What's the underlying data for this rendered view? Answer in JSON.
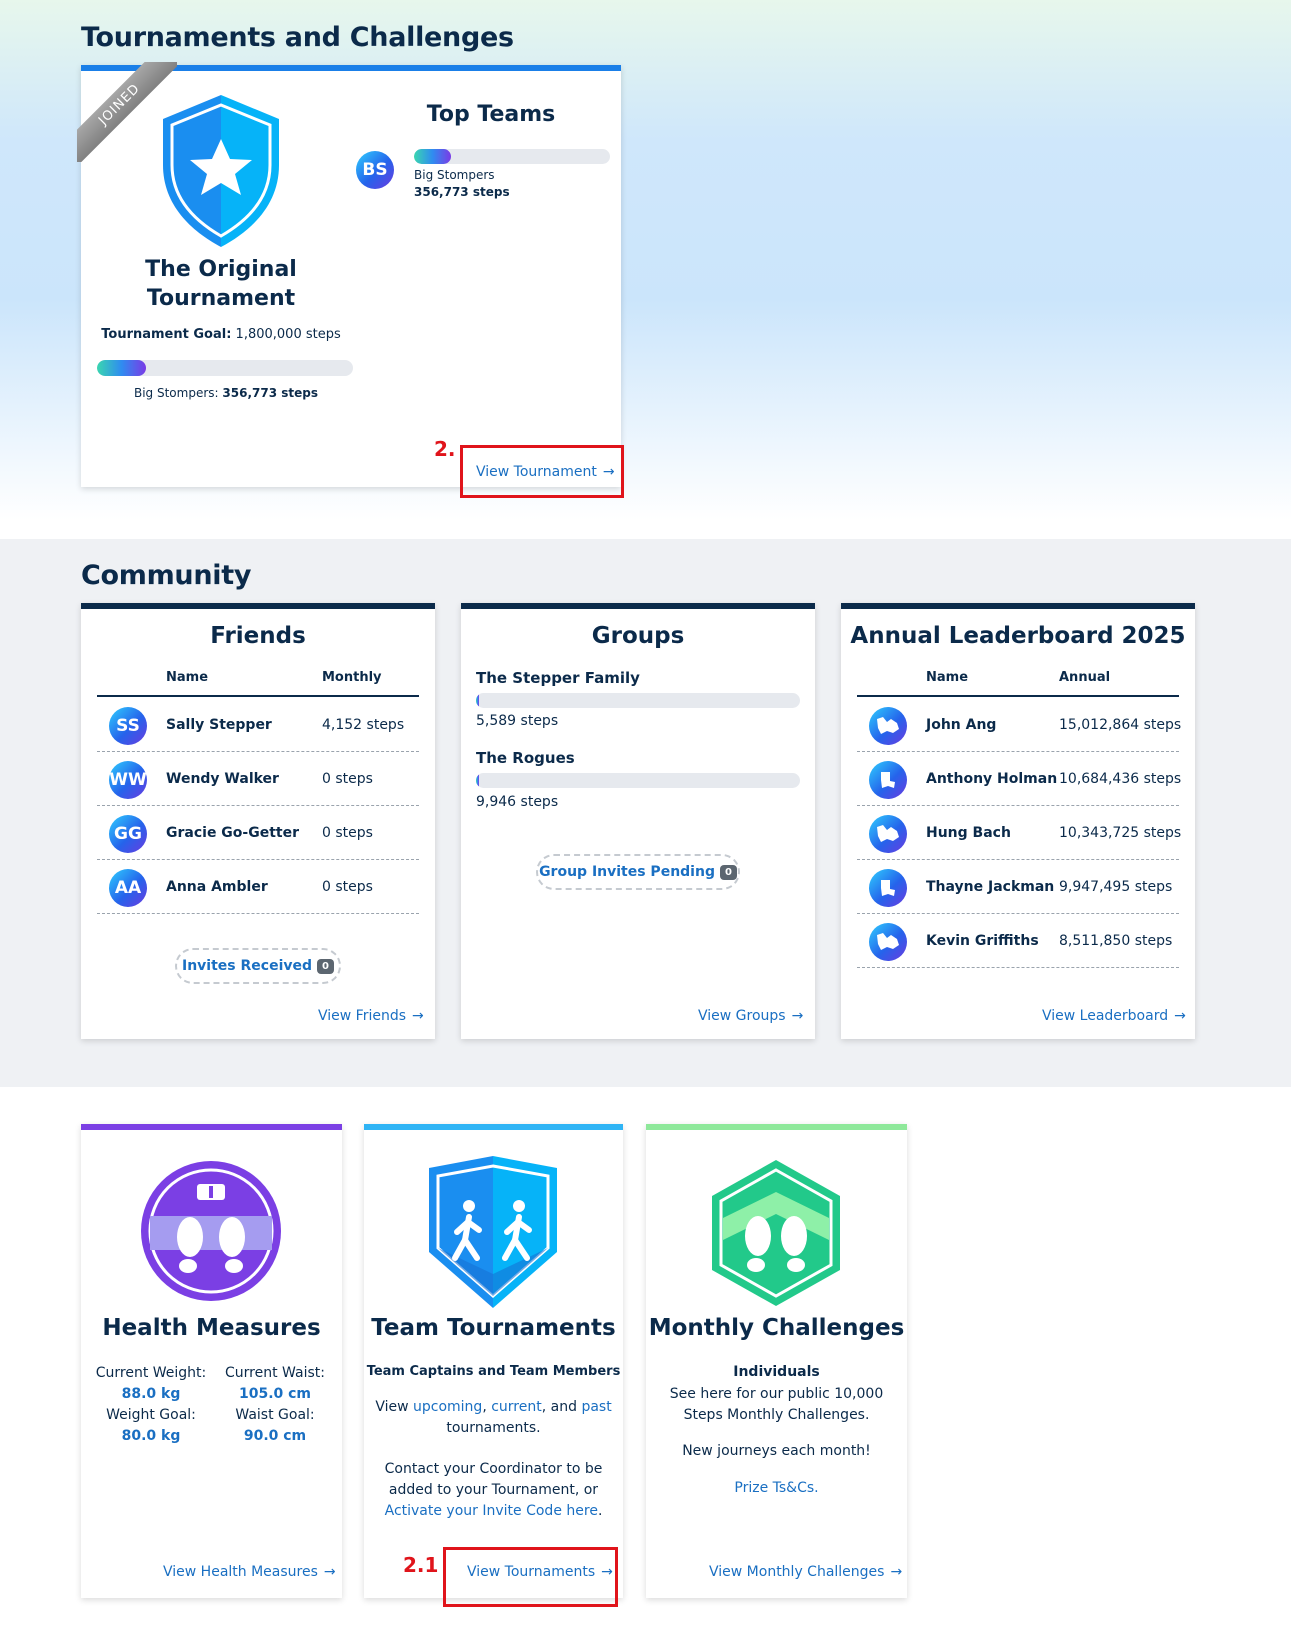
{
  "tournaments": {
    "section_title": "Tournaments and Challenges",
    "card": {
      "ribbon": "JOINED",
      "name_line1": "The Original",
      "name_line2": "Tournament",
      "goal_label": "Tournament Goal:",
      "goal_value": "1,800,000 steps",
      "progress_fraction": 0.19,
      "progress_label": "Big Stompers:",
      "progress_value": "356,773 steps",
      "top_teams_title": "Top Teams",
      "top_team": {
        "initials": "BS",
        "name": "Big Stompers",
        "steps": "356,773 steps",
        "fraction": 0.19
      },
      "view_link": "View Tournament",
      "annotation": "2."
    }
  },
  "community": {
    "section_title": "Community",
    "friends": {
      "title": "Friends",
      "col_name": "Name",
      "col_value": "Monthly",
      "rows": [
        {
          "initials": "SS",
          "name": "Sally Stepper",
          "value": "4,152 steps"
        },
        {
          "initials": "WW",
          "name": "Wendy Walker",
          "value": "0 steps"
        },
        {
          "initials": "GG",
          "name": "Gracie Go-Getter",
          "value": "0 steps"
        },
        {
          "initials": "AA",
          "name": "Anna Ambler",
          "value": "0 steps"
        }
      ],
      "invites_label": "Invites Received",
      "invites_count": "0",
      "view_link": "View Friends"
    },
    "groups": {
      "title": "Groups",
      "items": [
        {
          "name": "The Stepper Family",
          "steps": "5,589 steps",
          "fraction": 0.01
        },
        {
          "name": "The Rogues",
          "steps": "9,946 steps",
          "fraction": 0.01
        }
      ],
      "pending_label": "Group Invites Pending",
      "pending_count": "0",
      "view_link": "View Groups"
    },
    "leaderboard": {
      "title": "Annual Leaderboard 2025",
      "col_name": "Name",
      "col_value": "Annual",
      "rows": [
        {
          "name": "John Ang",
          "value": "15,012,864 steps"
        },
        {
          "name": "Anthony Holman",
          "value": "10,684,436 steps"
        },
        {
          "name": "Hung Bach",
          "value": "10,343,725 steps"
        },
        {
          "name": "Thayne Jackman",
          "value": "9,947,495 steps"
        },
        {
          "name": "Kevin Griffiths",
          "value": "8,511,850 steps"
        }
      ],
      "view_link": "View Leaderboard"
    }
  },
  "health": {
    "title": "Health Measures",
    "weight_label": "Current Weight:",
    "weight_value": "88.0 kg",
    "waist_label": "Current Waist:",
    "waist_value": "105.0 cm",
    "weight_goal_label": "Weight Goal:",
    "weight_goal_value": "80.0 kg",
    "waist_goal_label": "Waist Goal:",
    "waist_goal_value": "90.0 cm",
    "view_link": "View Health Measures",
    "accent": "#7b3fe4"
  },
  "team_tournaments": {
    "title": "Team Tournaments",
    "subtitle": "Team Captains and Team Members",
    "view_prefix": "View ",
    "upcoming": "upcoming",
    "comma1": ", ",
    "current": "current",
    "and": ", and ",
    "past": "past",
    "tournaments_word": "tournaments.",
    "contact_line1": "Contact your Coordinator to be",
    "contact_line2": "added to your Tournament, or",
    "activate_link": "Activate your Invite Code here",
    "period": ".",
    "view_link": "View Tournaments",
    "annotation": "2.1",
    "accent": "#2fb4f5"
  },
  "monthly": {
    "title": "Monthly Challenges",
    "subtitle": "Individuals",
    "line1": "See here for our public 10,000",
    "line2": "Steps Monthly Challenges.",
    "line3": "New journeys each month!",
    "prize_link": "Prize Ts&Cs.",
    "view_link": "View Monthly Challenges",
    "accent": "#8ee89a"
  }
}
